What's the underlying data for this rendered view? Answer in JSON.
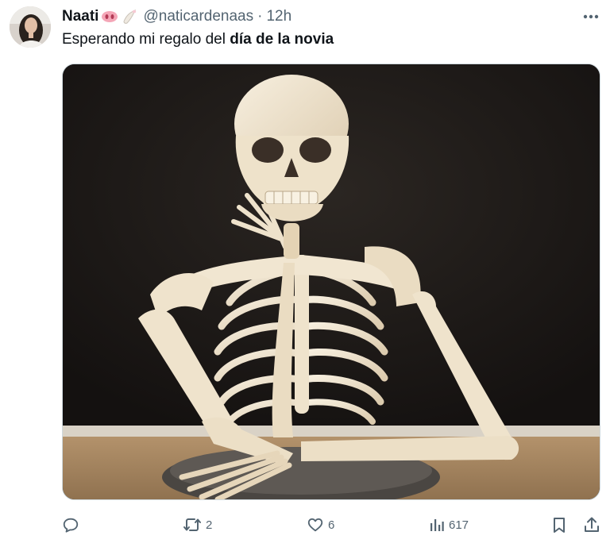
{
  "tweet": {
    "author": {
      "display_name": "Naati",
      "handle": "@naticardenaas",
      "separator": "·",
      "time": "12h",
      "emojis": [
        "pig-nose-icon",
        "nail-polish-icon"
      ]
    },
    "text_normal": "Esperando mi regalo del ",
    "text_bold": "día de la novia",
    "media": {
      "description_icon": "skeleton-waiting-image"
    },
    "actions": {
      "reply_count": "",
      "retweet_count": "2",
      "like_count": "6",
      "views_count": "617"
    }
  },
  "colors": {
    "text_primary": "#0f1419",
    "text_secondary": "#536471",
    "border": "#cfd9de"
  }
}
